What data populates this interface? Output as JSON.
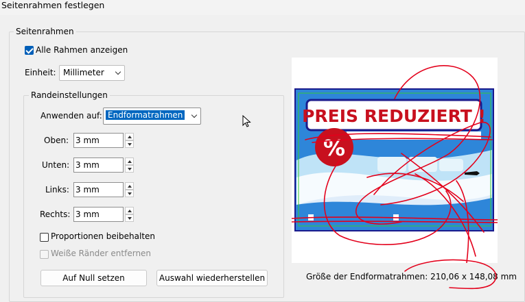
{
  "window": {
    "title": "Seitenrahmen festlegen"
  },
  "group_page_frames": {
    "legend": "Seitenrahmen"
  },
  "show_all_frames": {
    "label": "Alle Rahmen anzeigen",
    "checked": true
  },
  "unit": {
    "label": "Einheit:",
    "value": "Millimeter"
  },
  "margin_settings": {
    "legend": "Randeinstellungen",
    "apply_to": {
      "label": "Anwenden auf:",
      "value": "Endformatrahmen"
    },
    "fields": [
      {
        "label": "Oben:",
        "value": "3 mm"
      },
      {
        "label": "Unten:",
        "value": "3 mm"
      },
      {
        "label": "Links:",
        "value": "3 mm"
      },
      {
        "label": "Rechts:",
        "value": "3 mm"
      }
    ],
    "keep_proportions": {
      "label": "Proportionen beibehalten",
      "checked": false
    },
    "remove_white_margins": {
      "label": "Weiße Ränder entfernen",
      "checked": false,
      "disabled": true
    },
    "reset_button": "Auf Null setzen",
    "restore_button": "Auswahl wiederherstellen"
  },
  "preview": {
    "banner_text": "PREIS REDUZIERT !",
    "percent_symbol": "%",
    "size_text": "Größe der Endformatrahmen: 210,06 x 148,08 mm"
  },
  "colors": {
    "accent": "#005fb8",
    "banner_red": "#c8101e",
    "frame_blue": "#1a1a8c",
    "scribble_red": "#e3001b"
  }
}
